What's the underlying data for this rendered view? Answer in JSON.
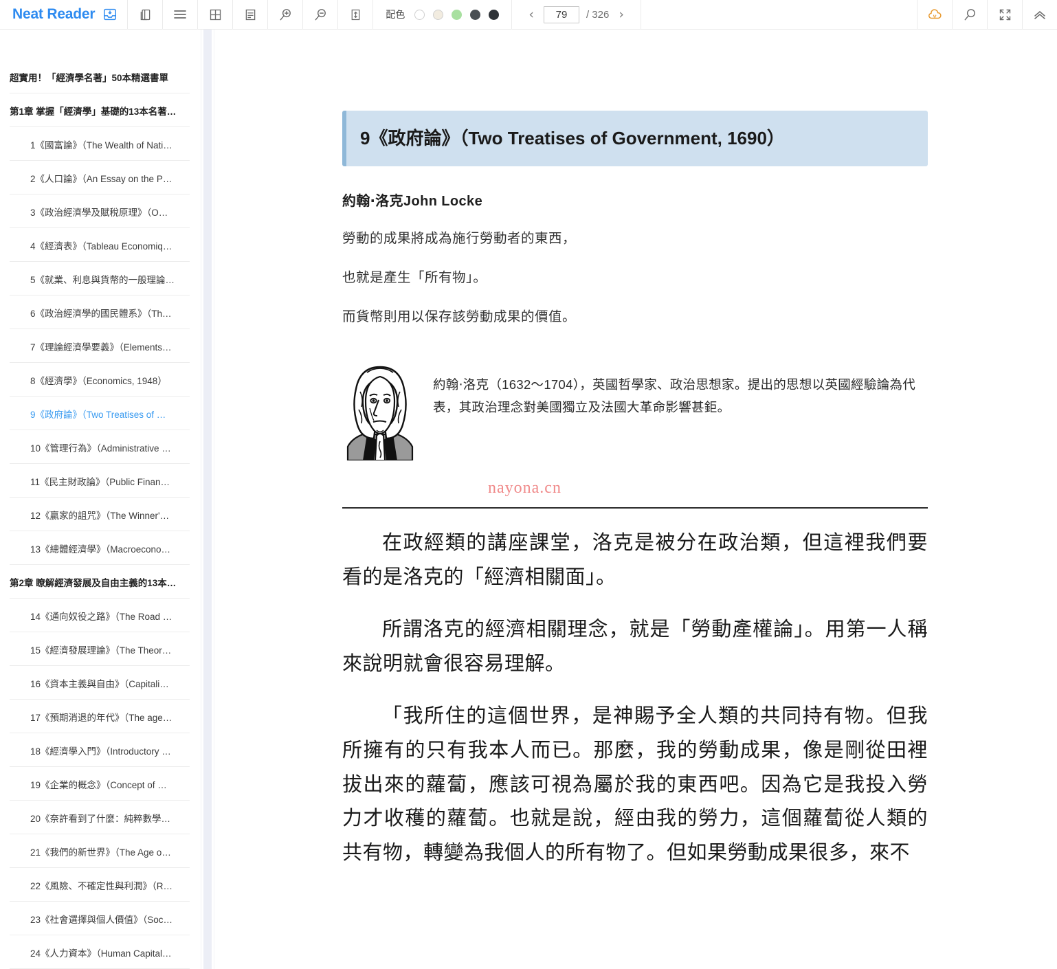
{
  "app": {
    "brand": "Neat Reader",
    "brand_icon": "library-save-icon"
  },
  "toolbar": {
    "buttons": [
      {
        "name": "copy-pages-icon",
        "title": "Copy"
      },
      {
        "name": "menu-icon",
        "title": "Contents"
      },
      {
        "name": "grid-view-icon",
        "title": "Grid"
      },
      {
        "name": "notes-icon",
        "title": "Notes"
      },
      {
        "name": "zoom-in-icon",
        "title": "Zoom in"
      },
      {
        "name": "zoom-out-icon",
        "title": "Zoom out"
      },
      {
        "name": "line-height-icon",
        "title": "Line height"
      }
    ],
    "palette_label": "配色",
    "palette_swatches": [
      "#ffffff",
      "#f2ece0",
      "#a8e0a0",
      "#4a4f54",
      "#2f3338"
    ],
    "pager": {
      "prev": "‹",
      "next": "›",
      "current": "79",
      "total": "/ 326"
    },
    "right_buttons": [
      {
        "name": "cloud-sync-icon",
        "title": "Cloud"
      },
      {
        "name": "search-icon",
        "title": "Search"
      },
      {
        "name": "fullscreen-icon",
        "title": "Fullscreen"
      },
      {
        "name": "collapse-up-icon",
        "title": "Collapse toolbar"
      }
    ]
  },
  "sidebar": {
    "items": [
      {
        "label": "超實用！「經濟學名著」50本精選書單",
        "level": 0,
        "active": false
      },
      {
        "label": "第1章 掌握「經濟學」基礎的13本名著…",
        "level": 1,
        "active": false
      },
      {
        "label": "1《國富論》（The Wealth of Nati…",
        "level": 2,
        "active": false
      },
      {
        "label": "2《人口論》（An Essay on the P…",
        "level": 2,
        "active": false
      },
      {
        "label": "3《政治經濟學及賦稅原理》（O…",
        "level": 2,
        "active": false
      },
      {
        "label": "4《經濟表》（Tableau Economiq…",
        "level": 2,
        "active": false
      },
      {
        "label": "5《就業、利息與貨幣的一般理論…",
        "level": 2,
        "active": false
      },
      {
        "label": "6《政治經濟學的國民體系》（Th…",
        "level": 2,
        "active": false
      },
      {
        "label": "7《理論經濟學要義》（Elements…",
        "level": 2,
        "active": false
      },
      {
        "label": "8《經濟學》（Economics, 1948）",
        "level": 2,
        "active": false
      },
      {
        "label": "9《政府論》（Two Treatises of …",
        "level": 2,
        "active": true
      },
      {
        "label": "10《管理行為》（Administrative …",
        "level": 2,
        "active": false
      },
      {
        "label": "11《民主財政論》（Public Finan…",
        "level": 2,
        "active": false
      },
      {
        "label": "12《贏家的詛咒》（The Winner'…",
        "level": 2,
        "active": false
      },
      {
        "label": "13《總體經濟學》（Macroecono…",
        "level": 2,
        "active": false
      },
      {
        "label": "第2章 瞭解經濟發展及自由主義的13本…",
        "level": 1,
        "active": false
      },
      {
        "label": "14《通向奴役之路》（The Road …",
        "level": 2,
        "active": false
      },
      {
        "label": "15《經濟發展理論》（The Theor…",
        "level": 2,
        "active": false
      },
      {
        "label": "16《資本主義與自由》（Capitali…",
        "level": 2,
        "active": false
      },
      {
        "label": "17《預期消退的年代》（The age…",
        "level": 2,
        "active": false
      },
      {
        "label": "18《經濟學入門》（Introductory …",
        "level": 2,
        "active": false
      },
      {
        "label": "19《企業的概念》（Concept of …",
        "level": 2,
        "active": false
      },
      {
        "label": "20《奈許看到了什麼：純粹數學…",
        "level": 2,
        "active": false
      },
      {
        "label": "21《我們的新世界》（The Age o…",
        "level": 2,
        "active": false
      },
      {
        "label": "22《風險、不確定性與利潤》（R…",
        "level": 2,
        "active": false
      },
      {
        "label": "23《社會選擇與個人價值》（Soc…",
        "level": 2,
        "active": false
      },
      {
        "label": "24《人力資本》（Human Capital…",
        "level": 2,
        "active": false
      }
    ]
  },
  "content": {
    "chapter_title": "9《政府論》（Two Treatises of Government, 1690）",
    "author": "約翰‧洛克John Locke",
    "lead_lines": [
      "勞動的成果將成為施行勞動者的東西，",
      "也就是產生「所有物」。",
      "而貨幣則用以保存該勞動成果的價值。"
    ],
    "portrait_name": "john-locke-portrait",
    "bio": "約翰‧洛克（1632～1704），英國哲學家、政治思想家。提出的思想以英國經驗論為代表，其政治理念對美國獨立及法國大革命影響甚鉅。",
    "watermark": "nayona.cn",
    "paragraphs": [
      "在政經類的講座課堂，洛克是被分在政治類，但這裡我們要看的是洛克的「經濟相關面」。",
      "所謂洛克的經濟相關理念，就是「勞動產權論」。用第一人稱來說明就會很容易理解。",
      "「我所住的這個世界，是神賜予全人類的共同持有物。但我所擁有的只有我本人而已。那麼，我的勞動成果，像是剛從田裡拔出來的蘿蔔，應該可視為屬於我的東西吧。因為它是我投入勞力才收穫的蘿蔔。也就是說，經由我的勞力，這個蘿蔔從人類的共有物，轉變為我個人的所有物了。但如果勞動成果很多，來不"
    ]
  },
  "colors": {
    "brand": "#2e8bf0",
    "active_item": "#3a9bf0",
    "title_bg": "#cfe0ef",
    "title_bar": "#8fb8d8",
    "watermark": "#f08a8a",
    "cloud_icon": "#e8992e"
  }
}
